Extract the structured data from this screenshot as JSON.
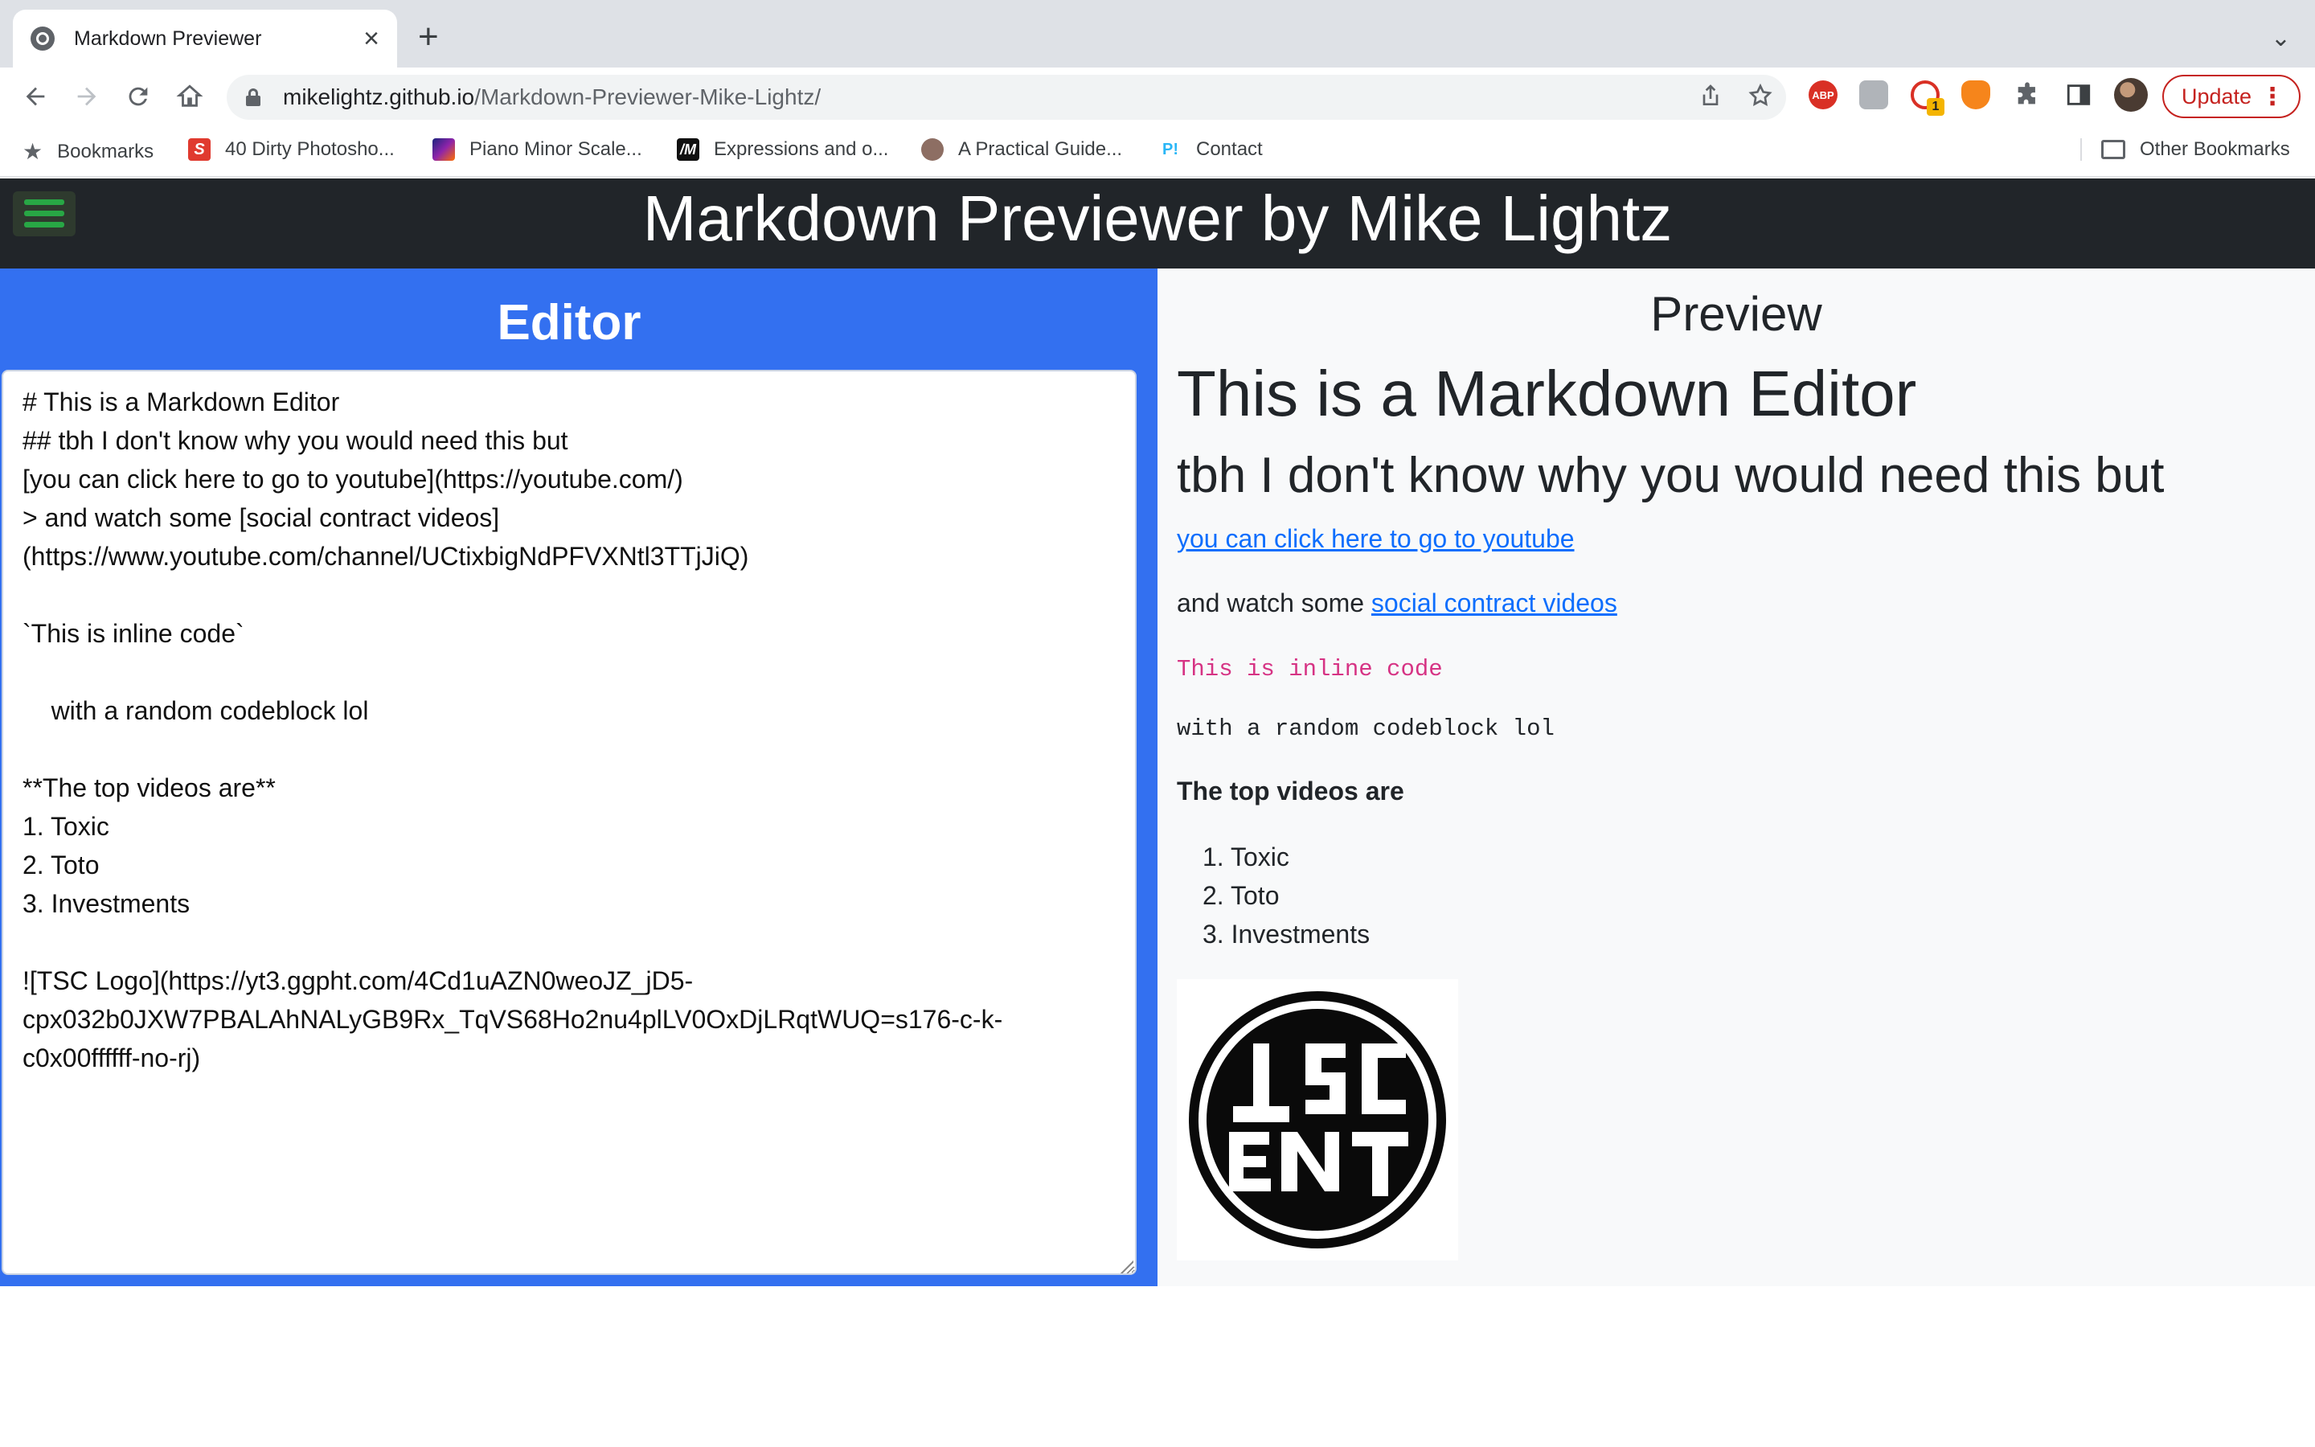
{
  "browser": {
    "tab_title": "Markdown Previewer",
    "tab_close": "×",
    "new_tab": "+",
    "tab_menu": "⌄",
    "url_host": "mikelightz.github.io",
    "url_path": "/Markdown-Previewer-Mike-Lightz/",
    "update_label": "Update",
    "bookmarks": [
      "Bookmarks",
      "40 Dirty Photosho...",
      "Piano Minor Scale...",
      "Expressions and o...",
      "A Practical Guide...",
      "Contact"
    ],
    "other_bookmarks": "Other Bookmarks",
    "extensions": [
      "ABP",
      "1"
    ]
  },
  "page": {
    "title": "Markdown Previewer by Mike Lightz",
    "editor_heading": "Editor",
    "editor_text": "# This is a Markdown Editor\n## tbh I don't know why you would need this but\n[you can click here to go to youtube](https://youtube.com/)\n> and watch some [social contract videos](https://www.youtube.com/channel/UCtixbigNdPFVXNtl3TTjJiQ)\n\n`This is inline code`\n\n    with a random codeblock lol\n\n**The top videos are**\n1. Toxic\n2. Toto\n3. Investments\n\n![TSC Logo](https://yt3.ggpht.com/4Cd1uAZN0weoJZ_jD5-cpx032b0JXW7PBALAhNALyGB9Rx_TqVS68Ho2nu4plLV0OxDjLRqtWUQ=s176-c-k-c0x00ffffff-no-rj)",
    "preview_heading": "Preview",
    "preview": {
      "h1": "This is a Markdown Editor",
      "h2": "tbh I don't know why you would need this but",
      "link": "you can click here to go to youtube",
      "quote_prefix": "and watch some",
      "quote_link": "social contract videos",
      "inline_code": "This is inline code",
      "code_block": "with a random codeblock lol",
      "strong": "The top videos are",
      "list": [
        "Toxic",
        "Toto",
        "Investments"
      ],
      "logo_alt": "TSC Logo",
      "logo_text": "TSC ENT"
    }
  },
  "colors": {
    "editor_bg": "#3370f0",
    "header_bg": "#212529",
    "link": "#0d6efd",
    "inline_code": "#d63384",
    "hamburger": "#28a745"
  }
}
